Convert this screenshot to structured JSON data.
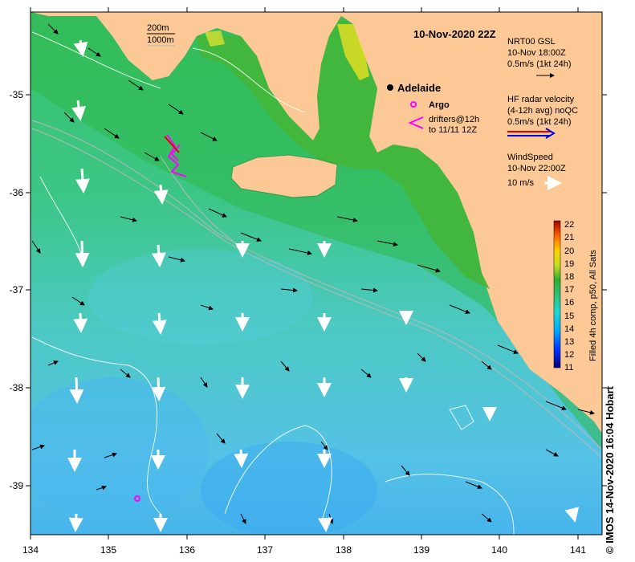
{
  "title": "10-Nov-2020 22Z",
  "colors": {
    "land": "#fbc896",
    "ocean_warm": "#2fb84a",
    "ocean_mid": "#3fc98f",
    "ocean_cool": "#54c8e8",
    "ocean_cold": "#3aaee8",
    "contour": "#b8b8b8",
    "front": "#ffffff",
    "argo": "#ff00ff",
    "current": "#000000"
  },
  "depth_legend": {
    "line1": "200m",
    "line2": "1000m"
  },
  "places": {
    "adelaide": {
      "label": "Adelaide",
      "lon": 138.6,
      "lat": -34.93
    }
  },
  "argo": {
    "label": "Argo",
    "float_lon": 135.37,
    "float_lat": -39.13
  },
  "drifters": {
    "line1": "drifters@12h",
    "line2": "to 11/11 12Z"
  },
  "legends": {
    "gsl": {
      "line1": "NRT00 GSL",
      "line2": "10-Nov 18:00Z",
      "line3": "0.5m/s (1kt 24h)"
    },
    "hf": {
      "line1": "HF radar velocity",
      "line2": "(4-12h avg) noQC",
      "line3": "0.5m/s (1kt 24h)"
    },
    "wind": {
      "line1": "WindSpeed",
      "line2": "10-Nov 22:00Z",
      "line3": "10 m/s"
    }
  },
  "colorbar": {
    "label": "Filled 4h comp, p50, All Sats",
    "ticks": [
      "11",
      "12",
      "13",
      "14",
      "15",
      "16",
      "17",
      "18",
      "19",
      "20",
      "21",
      "22"
    ]
  },
  "axes": {
    "x_ticks": [
      "134",
      "135",
      "136",
      "137",
      "138",
      "139",
      "140",
      "141"
    ],
    "y_ticks": [
      "-35",
      "-36",
      "-37",
      "-38",
      "-39"
    ],
    "xlim": [
      134,
      141.3
    ],
    "ylim": [
      -39.5,
      -34.2
    ]
  },
  "copyright": "© IMOS 14-Nov-2020 16:04 Hobart"
}
